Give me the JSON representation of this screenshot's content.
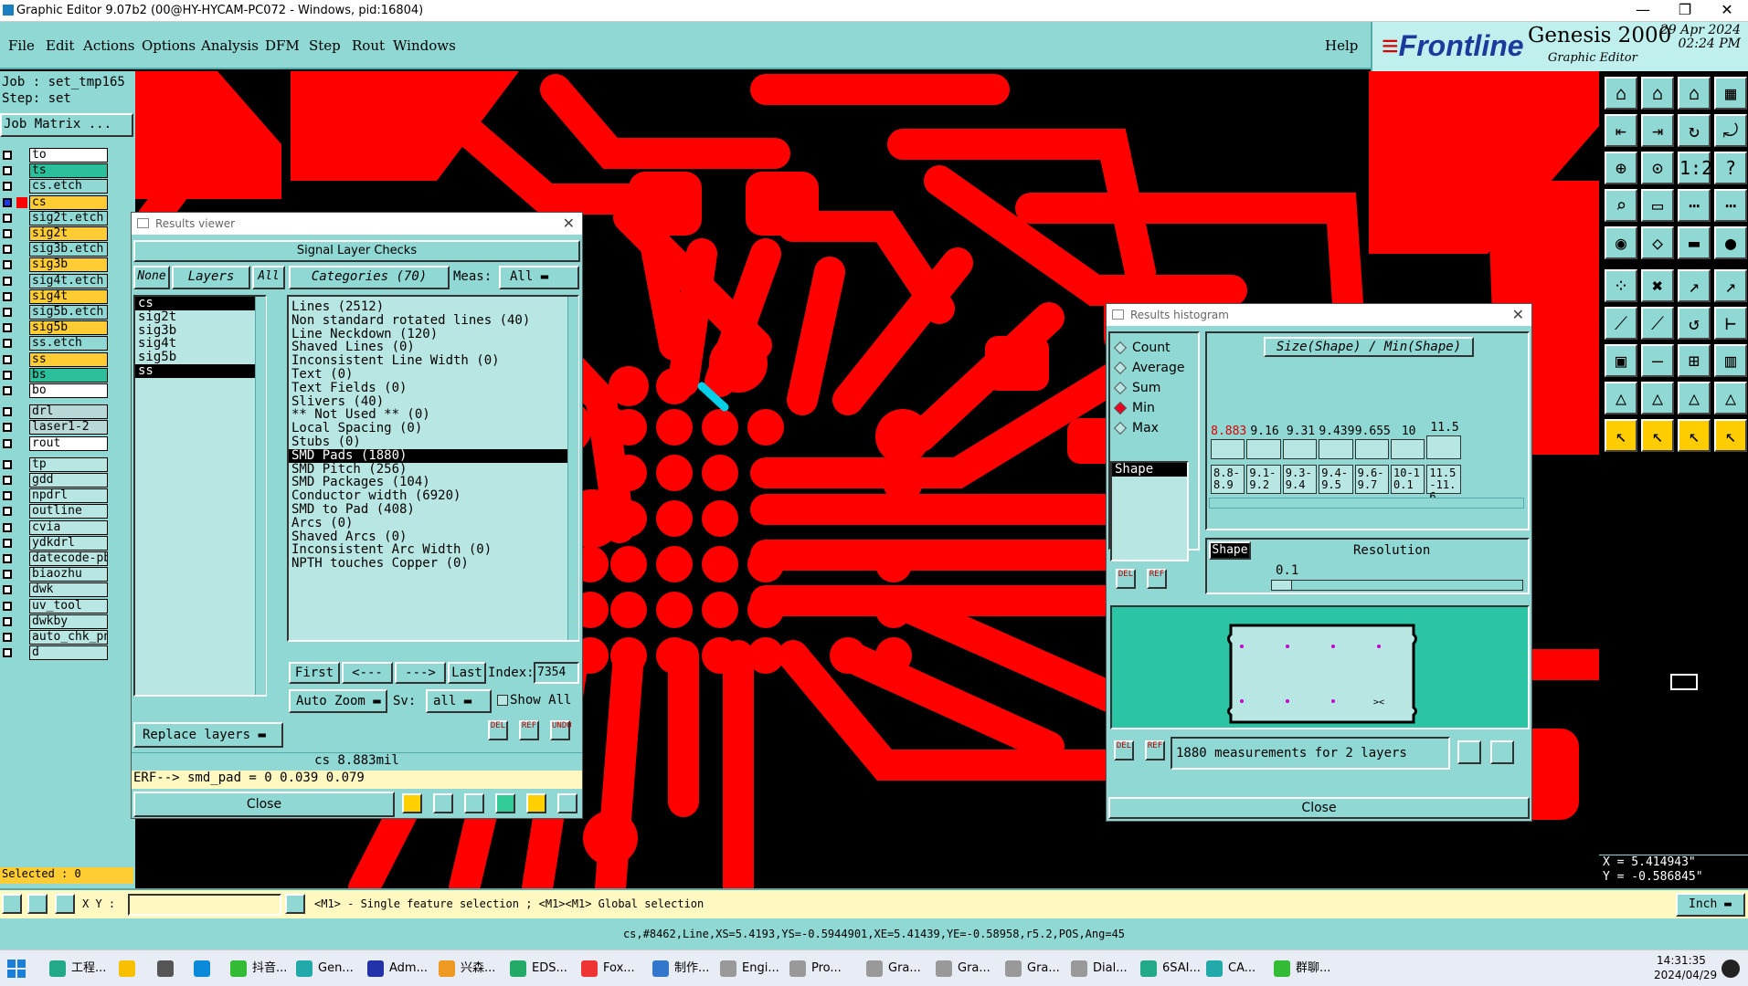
{
  "window": {
    "title": "Graphic Editor 9.07b2 (00@HY-HYCAM-PC072 - Windows, pid:16804)"
  },
  "menu": [
    "File",
    "Edit",
    "Actions",
    "Options",
    "Analysis",
    "DFM",
    "Step",
    "Rout",
    "Windows"
  ],
  "help": "Help",
  "brand": {
    "logo_text": "Frontline",
    "product": "Genesis 2000",
    "subtitle": "Graphic Editor",
    "date": "29 Apr 2024",
    "time": "02:24 PM"
  },
  "job": {
    "job_label": "Job : set_tmp165",
    "step_label": "Step: set",
    "matrix_button": "Job Matrix ..."
  },
  "layers": [
    {
      "name": "to",
      "color": "#ffffff",
      "checked": false
    },
    {
      "name": "ts",
      "color": "#2bbf9c",
      "checked": false
    },
    {
      "name": "cs.etch",
      "color": "#8fd8d4",
      "checked": false
    },
    {
      "name": "cs",
      "color": "#ffcc33",
      "checked": true
    },
    {
      "name": "sig2t.etch",
      "color": "#8fd8d4",
      "checked": false
    },
    {
      "name": "sig2t",
      "color": "#ffcc33",
      "checked": false
    },
    {
      "name": "sig3b.etch",
      "color": "#8fd8d4",
      "checked": false
    },
    {
      "name": "sig3b",
      "color": "#ffcc33",
      "checked": false
    },
    {
      "name": "sig4t.etch",
      "color": "#8fd8d4",
      "checked": false
    },
    {
      "name": "sig4t",
      "color": "#ffcc33",
      "checked": false
    },
    {
      "name": "sig5b.etch",
      "color": "#8fd8d4",
      "checked": false
    },
    {
      "name": "sig5b",
      "color": "#ffcc33",
      "checked": false
    },
    {
      "name": "ss.etch",
      "color": "#8fd8d4",
      "checked": false
    },
    {
      "name": "ss",
      "color": "#ffcc33",
      "checked": false
    },
    {
      "name": "bs",
      "color": "#2bbf9c",
      "checked": false
    },
    {
      "name": "bo",
      "color": "#ffffff",
      "checked": false
    },
    {
      "name": "drl",
      "color": "#b8d8d8",
      "checked": false
    },
    {
      "name": "laser1-2",
      "color": "#b8d8d8",
      "checked": false
    },
    {
      "name": "rout",
      "color": "#ffffff",
      "checked": false
    },
    {
      "name": "tp",
      "color": "#b8e6e3",
      "checked": false
    },
    {
      "name": "gdd",
      "color": "#b8e6e3",
      "checked": false
    },
    {
      "name": "npdrl",
      "color": "#b8e6e3",
      "checked": false
    },
    {
      "name": "outline",
      "color": "#b8e6e3",
      "checked": false
    },
    {
      "name": "cvia",
      "color": "#b8e6e3",
      "checked": false
    },
    {
      "name": "ydkdrl",
      "color": "#b8e6e3",
      "checked": false
    },
    {
      "name": "datecode-pbs",
      "color": "#b8e6e3",
      "checked": false
    },
    {
      "name": "biaozhu",
      "color": "#b8e6e3",
      "checked": false
    },
    {
      "name": "dwk",
      "color": "#b8e6e3",
      "checked": false
    },
    {
      "name": "uv_tool",
      "color": "#b8e6e3",
      "checked": false
    },
    {
      "name": "dwkby",
      "color": "#b8e6e3",
      "checked": false
    },
    {
      "name": "auto_chk_pnl",
      "color": "#b8e6e3",
      "checked": false
    },
    {
      "name": "d",
      "color": "#b8e6e3",
      "checked": false
    }
  ],
  "selected": "Selected : 0",
  "results_viewer": {
    "title": "Results viewer",
    "header": "Signal Layer Checks",
    "none_btn": "None",
    "layers_btn": "Layers",
    "all_btn": "All",
    "categories_btn": "Categories (70)",
    "meas_label": "Meas:",
    "meas_value": "All",
    "layer_list": [
      "cs",
      "sig2t",
      "sig3b",
      "sig4t",
      "sig5b",
      "ss"
    ],
    "categories": [
      "Lines (2512)",
      "Non standard rotated lines (40)",
      "Line Neckdown (120)",
      "Shaved Lines (0)",
      "Inconsistent Line Width (0)",
      "Text (0)",
      "Text Fields (0)",
      "Slivers (40)",
      "** Not Used ** (0)",
      "Local Spacing (0)",
      "Stubs (0)",
      "SMD Pads (1880)",
      "SMD Pitch (256)",
      "SMD Packages (104)",
      "Conductor width (6920)",
      "SMD to Pad (408)",
      "Arcs (0)",
      "Shaved Arcs (0)",
      "Inconsistent Arc Width (0)",
      "NPTH touches Copper (0)"
    ],
    "selected_category": "SMD Pads (1880)",
    "first": "First",
    "prev": "<---",
    "next": "--->",
    "last": "Last",
    "index_label": "Index:",
    "index_value": "7354",
    "auto_zoom": "Auto Zoom",
    "sv_label": "Sv:",
    "sv_value": "all",
    "show_all": "Show All",
    "replace_layers": "Replace layers",
    "value_line": "cs 8.883mil",
    "erf_line": "ERF--> smd_pad = 0 0.039 0.079",
    "close": "Close",
    "icons": {
      "del": "DEL",
      "ref": "REF",
      "undo": "UNDO"
    }
  },
  "histogram": {
    "title": "Results histogram",
    "options": [
      "Count",
      "Average",
      "Sum",
      "Min",
      "Max"
    ],
    "selected_option": "Min",
    "shape_item": "Shape",
    "chart_title": "Size(Shape) / Min(Shape)",
    "bin_values": [
      "8.883",
      "9.16",
      "9.31",
      "9.439",
      "9.655",
      "10",
      "11.5"
    ],
    "bin_ranges": [
      "8.8-8.9",
      "9.1-9.2",
      "9.3-9.4",
      "9.4-9.5",
      "9.6-9.7",
      "10-10.1",
      "11.5-11.6"
    ],
    "shape_btn": "Shape",
    "resolution_label": "Resolution",
    "resolution_value": "0.1",
    "measurements": "1880 measurements for 2 layers",
    "close": "Close"
  },
  "right_readout": {
    "x": "X = 5.414943\"",
    "y": "Y = -0.586845\""
  },
  "status": {
    "xy_label": "X Y :",
    "xy_value": "",
    "hint": "<M1> - Single feature selection ; <M1><M1> Global selection",
    "units": "Inch",
    "coord_line": "cs,#8462,Line,XS=5.4193,YS=-0.5944901,XE=5.41439,YE=-0.58958,r5.2,POS,Ang=45"
  },
  "taskbar": {
    "items": [
      "工程...",
      "",
      "",
      "",
      "抖音...",
      "Gen...",
      "Adm...",
      "兴森...",
      "EDS...",
      "Fox...",
      "制作...",
      "Engi...",
      "Pro...",
      "Gra...",
      "Gra...",
      "Gra...",
      "Dial...",
      "6SAI...",
      "CA...",
      "群聊..."
    ],
    "time": "14:31:35",
    "date": "2024/04/29"
  },
  "colors": {
    "bg": "#8fd8d4",
    "copper": "#ff0000",
    "highlight": "#00bfff"
  }
}
